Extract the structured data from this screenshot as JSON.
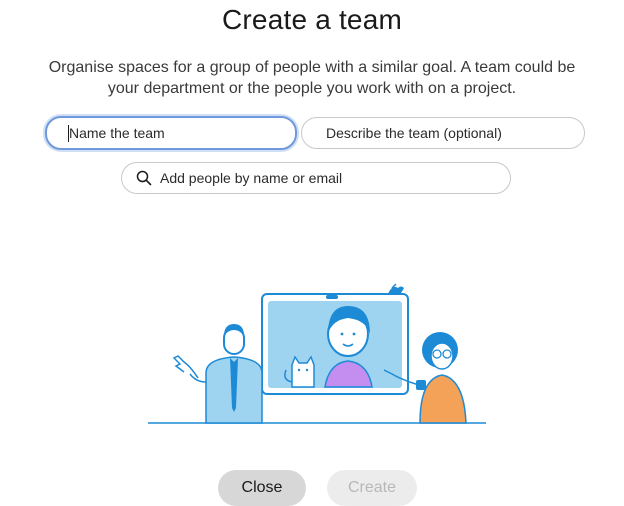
{
  "dialog": {
    "title": "Create a team",
    "subtitle_line1": "Organise spaces for a group of people with a similar goal. A team could be",
    "subtitle_line2": "your department or the people you work with on a project."
  },
  "form": {
    "name_placeholder": "Name the team",
    "description_placeholder": "Describe the team (optional)",
    "people_placeholder": "Add people by name or email"
  },
  "actions": {
    "close_label": "Close",
    "create_label": "Create"
  },
  "icons": {
    "search": "search-icon",
    "illustration": "team-video-call-illustration"
  },
  "colors": {
    "focus_ring": "#6f99dc",
    "accent_blue": "#1d8ad6",
    "illustration_blue": "#9fd4f1"
  }
}
